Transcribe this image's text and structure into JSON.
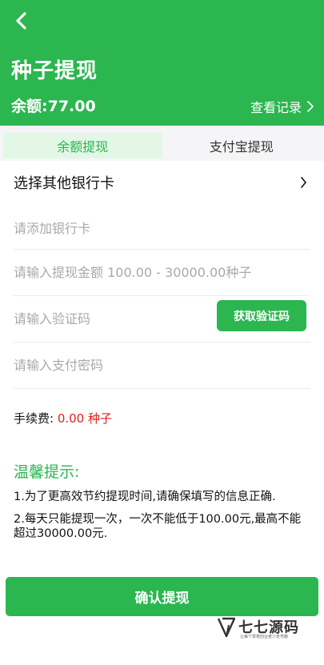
{
  "header": {
    "title": "种子提现",
    "balance_label": "余额:77.00",
    "records_label": "查看记录"
  },
  "tabs": [
    {
      "label": "余额提现",
      "active": true
    },
    {
      "label": "支付宝提现",
      "active": false
    }
  ],
  "form": {
    "select_bank_label": "选择其他银行卡",
    "bank_card_placeholder": "请添加银行卡",
    "amount_placeholder": "请输入提现金额 100.00 - 30000.00种子",
    "code_placeholder": "请输入验证码",
    "get_code_label": "获取验证码",
    "password_placeholder": "请输入支付密码"
  },
  "fee": {
    "label": "手续费: ",
    "amount": "0.00 种子"
  },
  "tips": {
    "title": "温馨提示:",
    "items": [
      "1.为了更高效节约提现时间,请确保填写的信息正确.",
      "2.每天只能提现一次，一次不能低于100.00元,最高不能超过30000.00元."
    ]
  },
  "submit_label": "确认提现",
  "watermark": {
    "name": "七七源码",
    "slogan": "让每个草根创业者少走弯路"
  },
  "colors": {
    "primary": "#2bb64f",
    "tab_active_bg": "#e2f7e6",
    "fee_amount": "#e02020"
  },
  "icons": {
    "back": "chevron-left-icon",
    "records": "chevron-right-icon",
    "select_bank": "chevron-right-icon"
  }
}
